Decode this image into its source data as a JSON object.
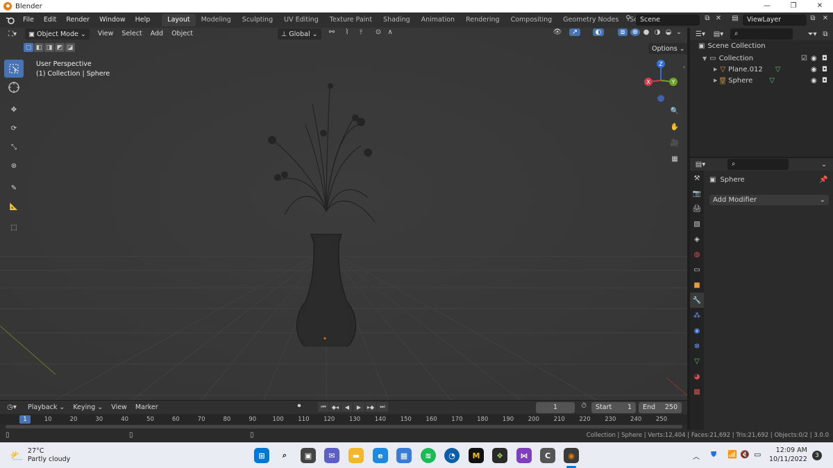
{
  "app": {
    "window_title": "Blender"
  },
  "menu": [
    "File",
    "Edit",
    "Render",
    "Window",
    "Help"
  ],
  "workspaces": [
    "Layout",
    "Modeling",
    "Sculpting",
    "UV Editing",
    "Texture Paint",
    "Shading",
    "Animation",
    "Rendering",
    "Compositing",
    "Geometry Nodes",
    "Scripting",
    "+"
  ],
  "scene": {
    "name": "Scene",
    "view_layer": "ViewLayer"
  },
  "viewport": {
    "mode": "Object Mode",
    "menus": [
      "View",
      "Select",
      "Add",
      "Object"
    ],
    "transform_orientation": "Global",
    "options_label": "Options",
    "info_line1": "User Perspective",
    "info_line2": "(1) Collection | Sphere",
    "gizmo": {
      "z": "Z",
      "x": "X",
      "y": "Y"
    }
  },
  "outliner": {
    "root": "Scene Collection",
    "collection": "Collection",
    "items": [
      "Plane.012",
      "Sphere"
    ]
  },
  "properties": {
    "object_name": "Sphere",
    "add_modifier": "Add Modifier"
  },
  "timeline": {
    "menus": [
      "Playback",
      "Keying",
      "View",
      "Marker"
    ],
    "current_frame": "1",
    "start_label": "Start",
    "start_value": "1",
    "end_label": "End",
    "end_value": "250",
    "ticks": [
      "1",
      "10",
      "20",
      "30",
      "40",
      "50",
      "60",
      "70",
      "80",
      "90",
      "100",
      "110",
      "120",
      "130",
      "140",
      "150",
      "160",
      "170",
      "180",
      "190",
      "200",
      "210",
      "220",
      "230",
      "240",
      "250"
    ]
  },
  "status": "Collection | Sphere | Verts:12,404 | Faces:21,692 | Tris:21,692 | Objects:0/2 | 3.0.0",
  "taskbar": {
    "weather_temp": "27°C",
    "weather_desc": "Partly cloudy",
    "time": "12:09 AM",
    "date": "10/11/2022",
    "notification_count": "3",
    "app_letters": {
      "m": "M",
      "c": "C"
    }
  },
  "colors": {
    "accent": "#4772b3",
    "viewport_bg": "#393939",
    "orange": "#e87d0d"
  }
}
